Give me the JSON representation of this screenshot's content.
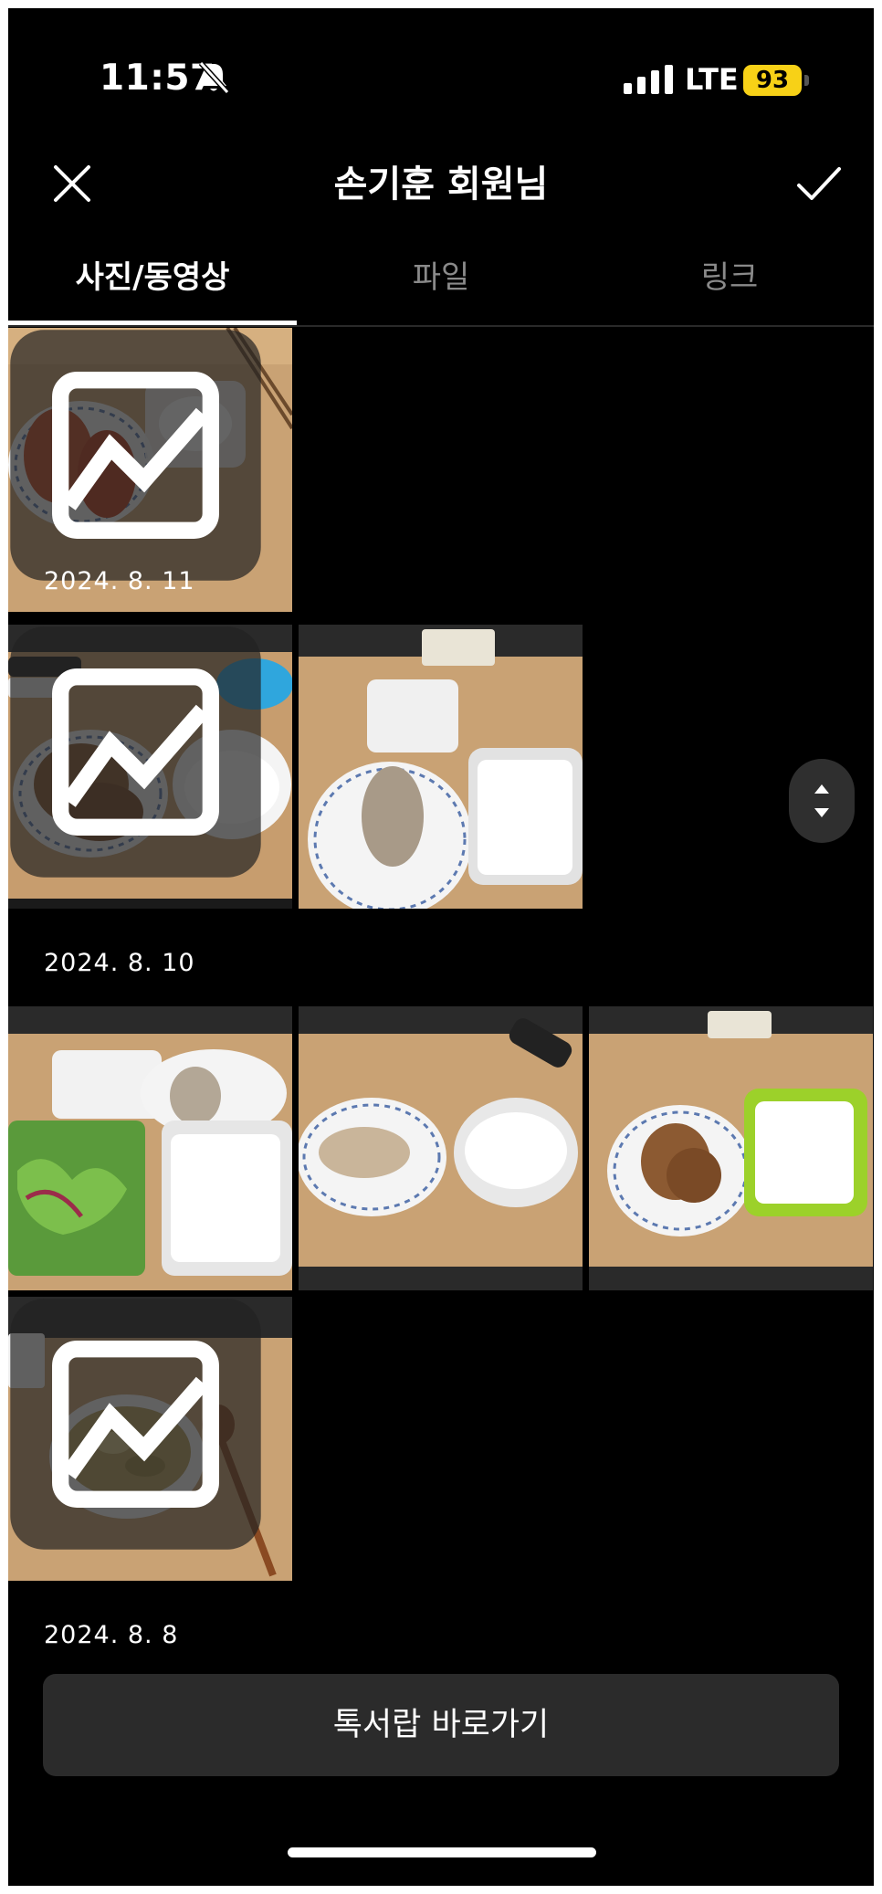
{
  "status_bar": {
    "time": "11:57",
    "network": "LTE",
    "battery": "93",
    "icons": [
      "bell-muted-icon",
      "signal-icon",
      "battery-icon"
    ]
  },
  "header": {
    "title": "손기훈 회원님",
    "left_icon": "close-icon",
    "right_icon": "check-icon"
  },
  "tabs": [
    {
      "label": "사진/동영상",
      "active": true
    },
    {
      "label": "파일",
      "active": false
    },
    {
      "label": "링크",
      "active": false
    }
  ],
  "sections": [
    {
      "date": "",
      "photos": [
        "chicken-sauce-rice",
        ""
      ]
    },
    {
      "date": "2024. 8. 11",
      "photos": [
        "grilled-chicken-rice",
        "chicken-breast-rice"
      ]
    },
    {
      "date": "2024. 8. 10",
      "photos": [
        "salad-chicken-rice",
        "chicken-rice-2",
        "chicken-green-box"
      ]
    },
    {
      "date": "",
      "photos": [
        "rice-bowl-spoon"
      ]
    },
    {
      "date": "2024. 8. 8",
      "photos": []
    }
  ],
  "bottom_button": {
    "label": "톡서랍 바로가기"
  },
  "colors": {
    "background": "#000000",
    "battery": "#f7d117",
    "button": "#2b2b2b"
  }
}
